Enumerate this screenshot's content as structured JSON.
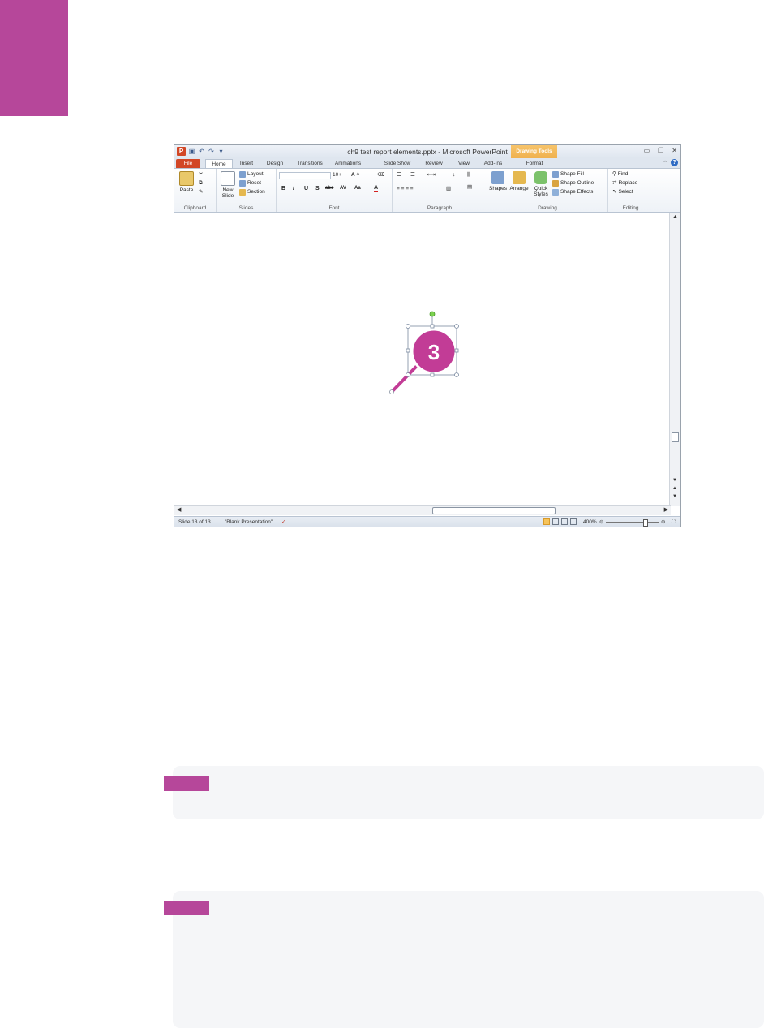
{
  "colors": {
    "accent": "#b6479a",
    "file_tab": "#d24726",
    "drawing_tools": "#eaa43c"
  },
  "window": {
    "title": "ch9 test report elements.pptx - Microsoft PowerPoint",
    "contextual_tab": "Drawing Tools"
  },
  "tabs": [
    "File",
    "Home",
    "Insert",
    "Design",
    "Transitions",
    "Animations",
    "Slide Show",
    "Review",
    "View",
    "Add-Ins",
    "Format"
  ],
  "ribbon": {
    "clipboard": {
      "paste": "Paste",
      "label": "Clipboard"
    },
    "slides": {
      "new_slide": "New Slide",
      "layout": "Layout",
      "reset": "Reset",
      "section": "Section",
      "label": "Slides"
    },
    "font": {
      "size": "10+",
      "label": "Font"
    },
    "paragraph": {
      "label": "Paragraph"
    },
    "drawing": {
      "shapes": "Shapes",
      "arrange": "Arrange",
      "quick_styles": "Quick Styles",
      "shape_fill": "Shape Fill",
      "shape_outline": "Shape Outline",
      "shape_effects": "Shape Effects",
      "label": "Drawing"
    },
    "editing": {
      "find": "Find",
      "replace": "Replace",
      "select": "Select",
      "label": "Editing"
    }
  },
  "callout_marker": {
    "number": "3"
  },
  "statusbar": {
    "slide": "Slide 13 of 13",
    "theme": "\"Blank Presentation\"",
    "zoom": "400%"
  }
}
